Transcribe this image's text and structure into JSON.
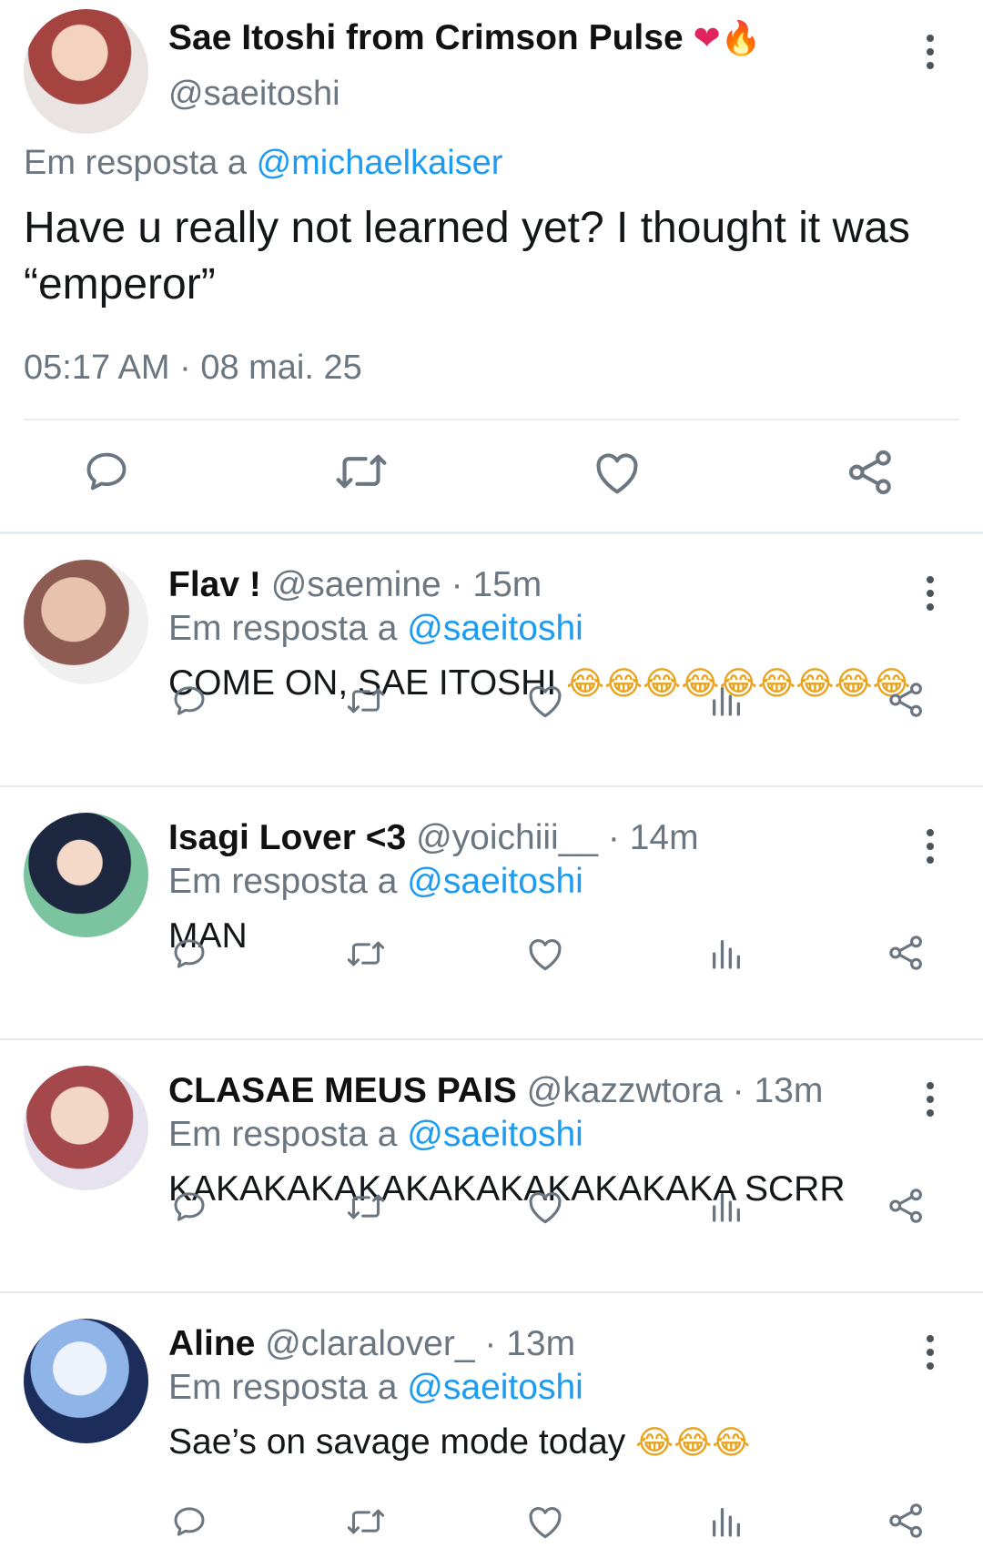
{
  "main_tweet": {
    "display_name": "Sae Itoshi from Crimson Pulse",
    "emoji": "❤🔥",
    "handle": "@saeitoshi",
    "reply_prefix": "Em resposta a",
    "reply_handle": "@michaelkaiser",
    "text": "Have u really not learned yet? I thought it was “emperor”",
    "timestamp": "05:17 AM · 08 mai. 25",
    "actions": [
      "reply-icon",
      "retweet-icon",
      "like-icon",
      "share-icon"
    ]
  },
  "replies": [
    {
      "name": "Flav !",
      "handle": "@saemine",
      "time": "· 15m",
      "reply_prefix": "Em resposta a",
      "reply_handle": "@saeitoshi",
      "text": "COME ON, SAE ITOSHI",
      "emoji": "😂😂😂😂😂😂😂😂😂"
    },
    {
      "name": "Isagi Lover <3",
      "handle": "@yoichiii__",
      "time": "· 14m",
      "reply_prefix": "Em resposta a",
      "reply_handle": "@saeitoshi",
      "text": "MAN",
      "emoji": ""
    },
    {
      "name": "CLASAE MEUS PAIS",
      "handle": "@kazzwtora",
      "time": "· 13m",
      "reply_prefix": "Em resposta a",
      "reply_handle": "@saeitoshi",
      "text": "KAKAKAKAKAKAKAKAKAKAKAKA SCRR",
      "emoji": ""
    },
    {
      "name": "Aline",
      "handle": "@claralover_",
      "time": "· 13m",
      "reply_prefix": "Em resposta a",
      "reply_handle": "@saeitoshi",
      "text": "Sae’s on savage mode today",
      "emoji": "😂😂😂"
    }
  ],
  "colors": {
    "accent": "#1d9bf0",
    "secondary_text": "#6b7680",
    "icon": "#6b7680"
  }
}
